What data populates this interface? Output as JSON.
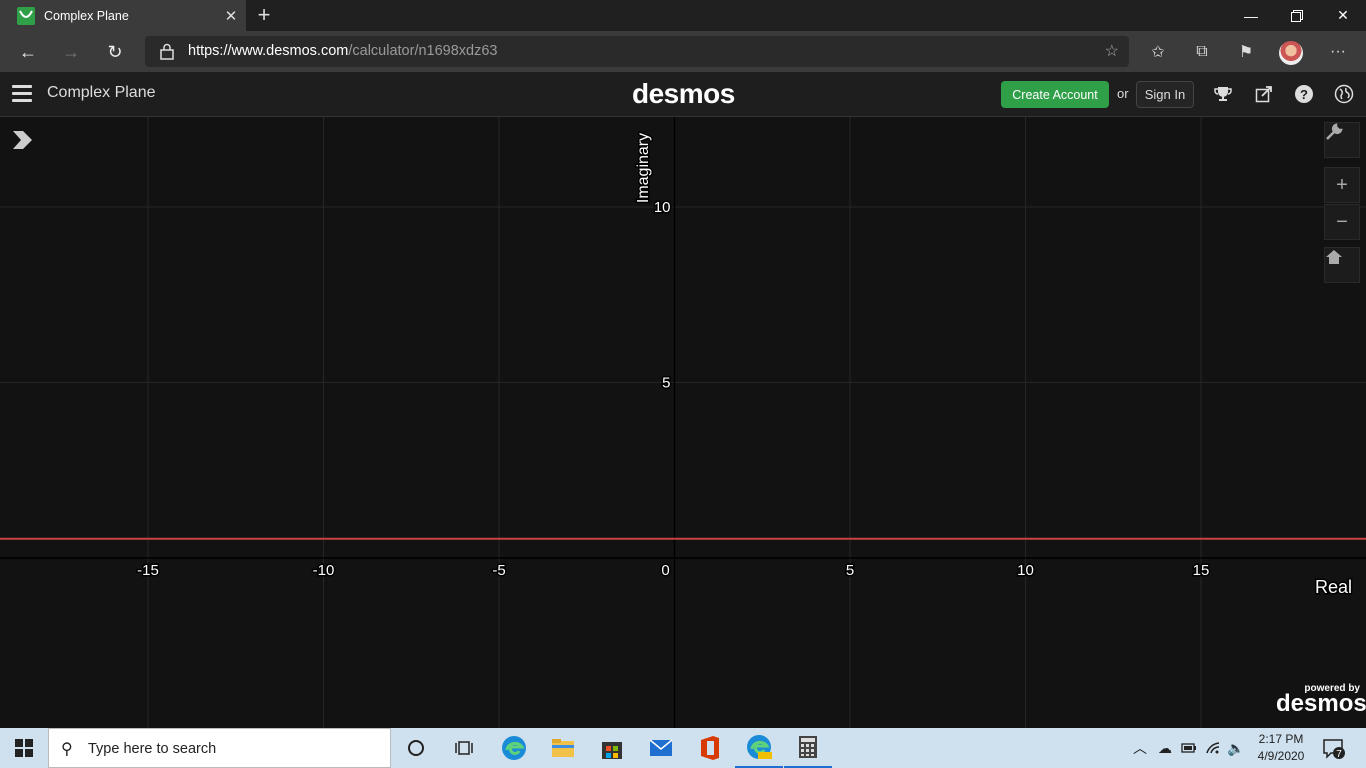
{
  "browser": {
    "tab_title": "Complex Plane",
    "url_domain": "https://www.desmos.com",
    "url_path": "/calculator/n1698xdz63"
  },
  "desmos": {
    "graph_title": "Complex Plane",
    "logo": "desmos",
    "create_account_label": "Create Account",
    "or_label": "or",
    "sign_in_label": "Sign In",
    "powered_by_label": "powered by",
    "powered_by_logo": "desmos",
    "accent_color": "#2f9f48"
  },
  "graph": {
    "x_axis_label": "Real",
    "y_axis_label": "Imaginary",
    "x_ticks": [
      "-15",
      "-10",
      "-5",
      "0",
      "5",
      "10",
      "15"
    ],
    "y_ticks": [
      "5",
      "10"
    ],
    "curve_color": "#c74440"
  },
  "taskbar": {
    "search_placeholder": "Type here to search",
    "time": "2:17 PM",
    "date": "4/9/2020",
    "notification_count": "7"
  }
}
